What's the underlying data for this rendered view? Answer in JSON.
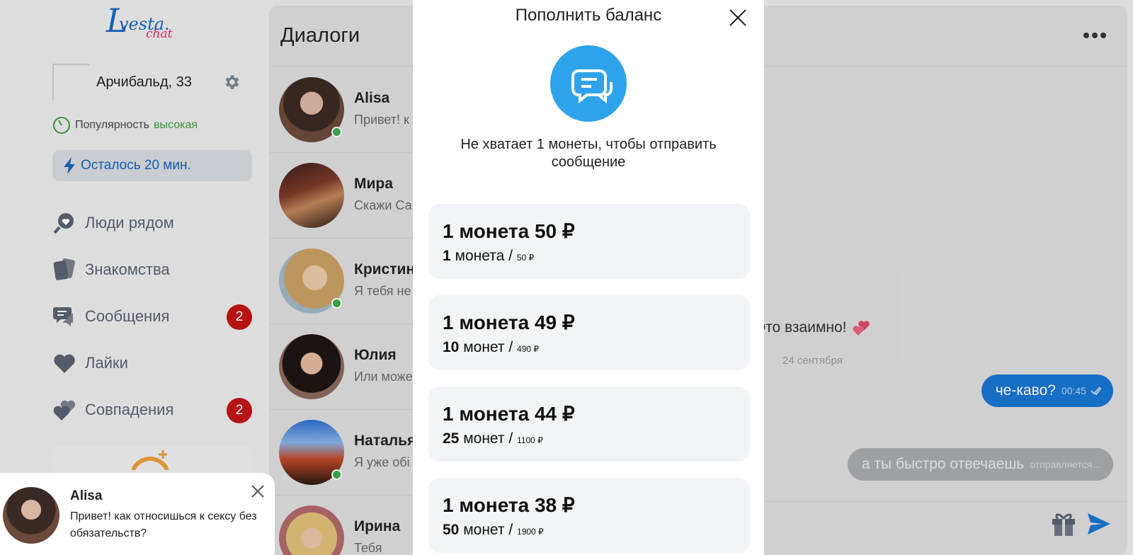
{
  "sidebar": {
    "logo": {
      "letter": "L",
      "brand": "vesta.",
      "sub": "chat"
    },
    "profile": {
      "name": "Арчибальд, 33"
    },
    "popularity": {
      "label": "Популярность",
      "value": "высокая"
    },
    "timer": {
      "label": "Осталось 20 мин."
    },
    "nav": [
      {
        "label": "Люди рядом"
      },
      {
        "label": "Знакомства"
      },
      {
        "label": "Сообщения",
        "badge": "2"
      },
      {
        "label": "Лайки"
      },
      {
        "label": "Совпадения",
        "badge": "2"
      }
    ]
  },
  "dialogs": {
    "title": "Диалоги",
    "items": [
      {
        "name": "Alisa",
        "preview": "Привет! к",
        "online": true
      },
      {
        "name": "Мира",
        "preview": "Скажи Са",
        "online": false
      },
      {
        "name": "Кристин",
        "preview": "Я тебя не",
        "online": true
      },
      {
        "name": "Юлия",
        "preview": "Или може",
        "online": false
      },
      {
        "name": "Наталья",
        "preview": "Я уже обі",
        "online": true
      },
      {
        "name": "Ирина",
        "preview": "Тебя",
        "online": false
      }
    ]
  },
  "chat": {
    "mutual": "Это взаимно!",
    "date": "24 сентября",
    "sent": {
      "text": "че-каво?",
      "time": "00:45"
    },
    "pending": {
      "text": "а ты быстро отвечаешь",
      "status": "отправляется..."
    }
  },
  "modal": {
    "title": "Пополнить баланс",
    "message": "Не хватает 1 монеты, чтобы отправить сообщение",
    "packages": [
      {
        "price": "1 монета 50 ₽",
        "count": "1",
        "unit": "монета /",
        "total": "50 ₽"
      },
      {
        "price": "1 монета 49 ₽",
        "count": "10",
        "unit": "монет /",
        "total": "490 ₽"
      },
      {
        "price": "1 монета 44 ₽",
        "count": "25",
        "unit": "монет /",
        "total": "1100 ₽"
      },
      {
        "price": "1 монета 38 ₽",
        "count": "50",
        "unit": "монет /",
        "total": "1900 ₽"
      }
    ]
  },
  "toast": {
    "name": "Alisa",
    "message": "Привет! как относишься к сексу без обязательств?"
  },
  "colors": {
    "accent": "#1976d2",
    "badge": "#c21616",
    "online": "#3caa4a",
    "modal_icon": "#2ea3ec"
  }
}
